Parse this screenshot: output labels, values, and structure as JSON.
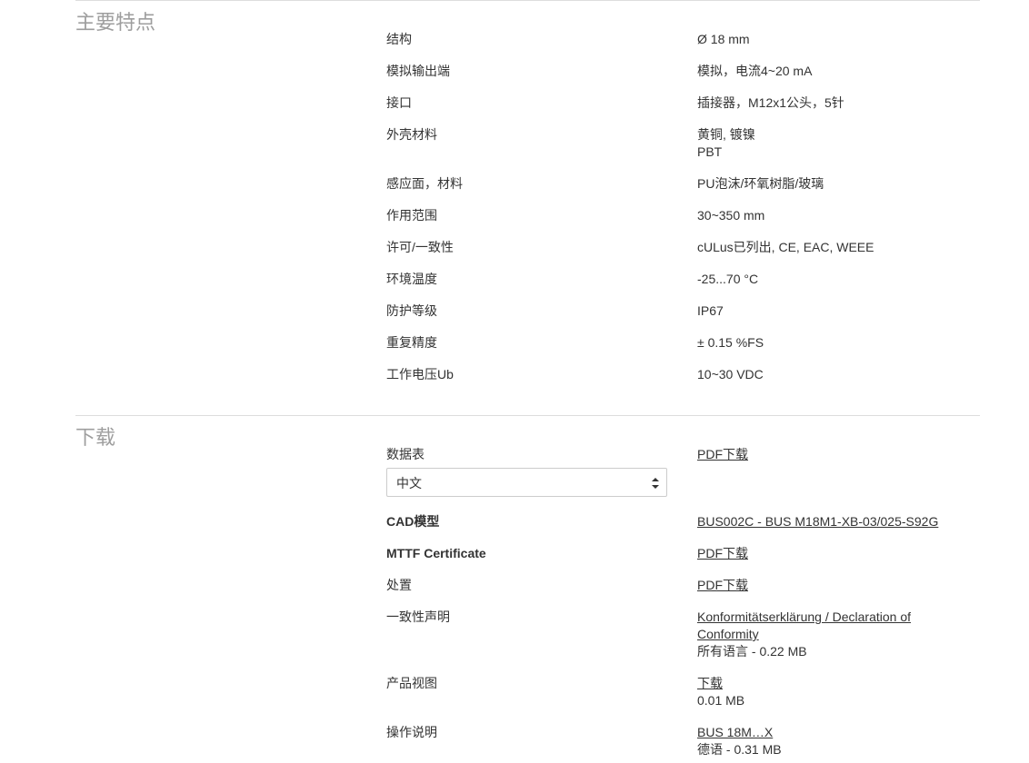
{
  "features": {
    "title": "主要特点",
    "rows": [
      {
        "label": "结构",
        "value": "Ø 18 mm"
      },
      {
        "label": "模拟输出端",
        "value": "模拟，电流4~20 mA"
      },
      {
        "label": "接口",
        "value": "插接器，M12x1公头，5针"
      },
      {
        "label": "外壳材料",
        "value": "黄铜, 镀镍",
        "value2": "PBT"
      },
      {
        "label": "感应面，材料",
        "value": "PU泡沫/环氧树脂/玻璃"
      },
      {
        "label": "作用范围",
        "value": "30~350 mm"
      },
      {
        "label": "许可/一致性",
        "value": "cULus已列出, CE, EAC, WEEE"
      },
      {
        "label": "环境温度",
        "value": "-25...70 °C"
      },
      {
        "label": "防护等级",
        "value": "IP67"
      },
      {
        "label": "重复精度",
        "value": "± 0.15 %FS"
      },
      {
        "label": "工作电压Ub",
        "value": "10~30 VDC"
      }
    ]
  },
  "downloads": {
    "title": "下载",
    "datasheet": {
      "label": "数据表",
      "link": "PDF下载",
      "language_selected": "中文"
    },
    "cad": {
      "label": "CAD模型",
      "link": "BUS002C - BUS M18M1-XB-03/025-S92G"
    },
    "mttf": {
      "label": "MTTF Certificate",
      "link": "PDF下载"
    },
    "disposal": {
      "label": "处置",
      "link": "PDF下载"
    },
    "conformity": {
      "label": "一致性声明",
      "link_line1": "Konformitätserklärung / Declaration of",
      "link_line2": "Conformity",
      "meta": "所有语言 - 0.22 MB"
    },
    "product_view": {
      "label": "产品视图",
      "link": "下载",
      "meta": "0.01 MB"
    },
    "manual": {
      "label": "操作说明",
      "link": "BUS 18M…X",
      "meta": "德语 - 0.31 MB"
    }
  }
}
